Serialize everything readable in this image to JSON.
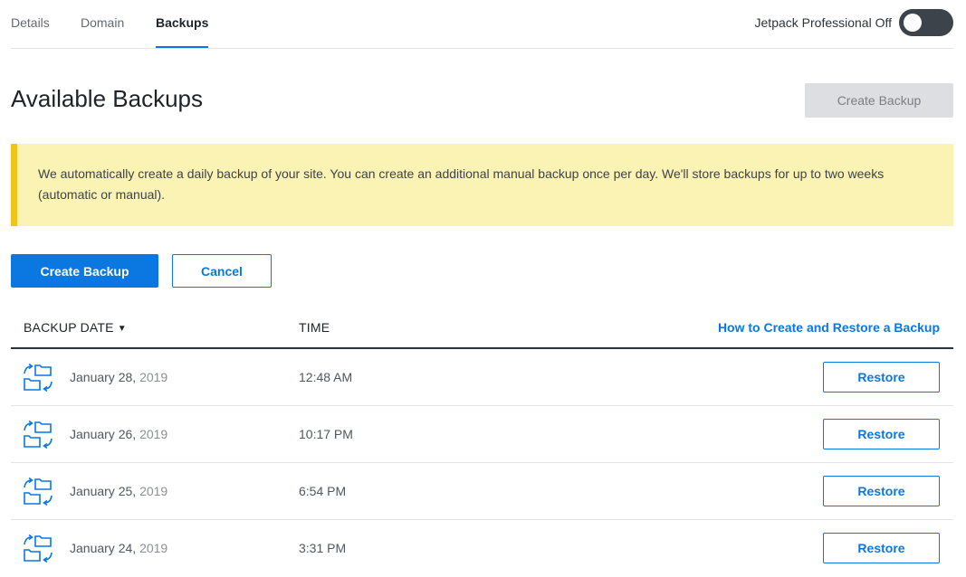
{
  "tabs": [
    {
      "label": "Details",
      "active": false
    },
    {
      "label": "Domain",
      "active": false
    },
    {
      "label": "Backups",
      "active": true
    }
  ],
  "jetpack": {
    "label": "Jetpack Professional Off",
    "enabled": false
  },
  "page": {
    "title": "Available Backups",
    "create_backup_label": "Create Backup"
  },
  "notice": {
    "text": "We automatically create a daily backup of your site. You can create an additional manual backup once per day. We'll store backups for up to two weeks (automatic or manual)."
  },
  "actions": {
    "create_label": "Create Backup",
    "cancel_label": "Cancel"
  },
  "table": {
    "col_date": "BACKUP DATE",
    "col_time": "TIME",
    "help_link": "How to Create and Restore a Backup",
    "rows": [
      {
        "date": "January 28,",
        "year": "2019",
        "time": "12:48 AM",
        "action": "Restore"
      },
      {
        "date": "January 26,",
        "year": "2019",
        "time": "10:17 PM",
        "action": "Restore"
      },
      {
        "date": "January 25,",
        "year": "2019",
        "time": "6:54 PM",
        "action": "Restore"
      },
      {
        "date": "January 24,",
        "year": "2019",
        "time": "3:31 PM",
        "action": "Restore"
      }
    ]
  },
  "colors": {
    "accent": "#0b77e0",
    "notice_bg": "#fbf3b3",
    "notice_border": "#f0c419",
    "toggle_off": "#3c434a"
  },
  "icons": {
    "row": "backup-restore-icon",
    "sort": "caret-down-icon"
  }
}
